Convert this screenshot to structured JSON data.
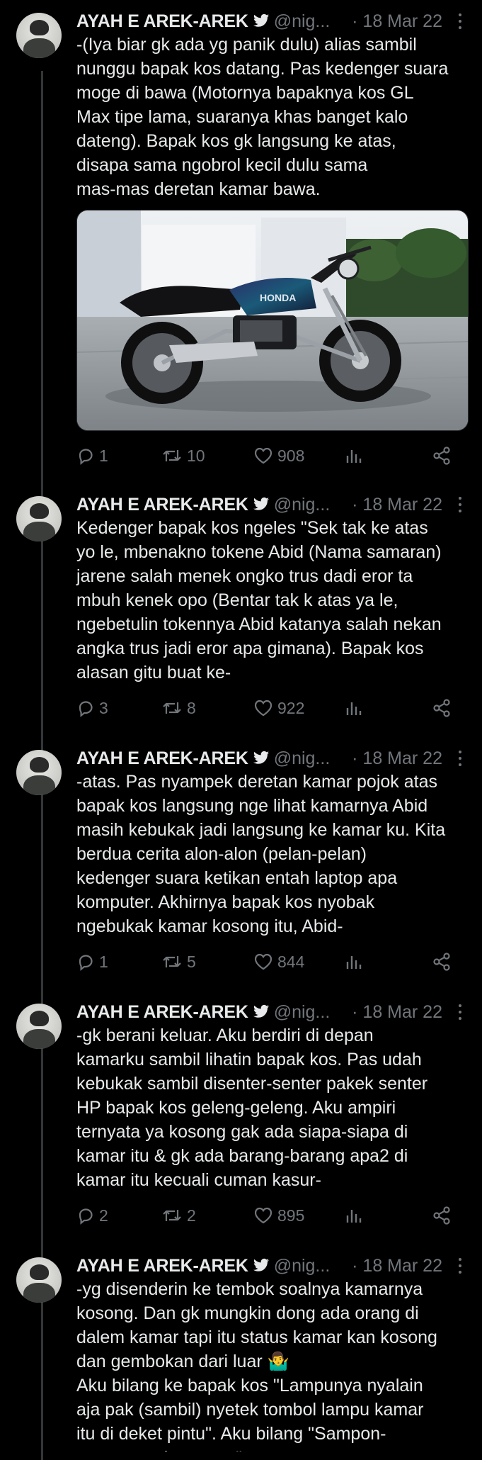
{
  "tweets": [
    {
      "name": "AYAH E AREK-AREK",
      "handle": "@nig...",
      "date": "· 18 Mar 22",
      "text": "-(Iya biar gk ada yg panik dulu) alias sambil\nnunggu bapak kos datang. Pas kedenger suara\nmoge di bawa (Motornya bapaknya kos GL\nMax tipe lama, suaranya khas banget kalo\ndateng). Bapak kos gk langsung ke atas,\ndisapa sama ngobrol kecil dulu sama\nmas-mas deretan kamar bawa.",
      "media": {
        "brand_text": "HONDA",
        "icon": "motorcycle-photo"
      },
      "replies": "1",
      "retweets": "10",
      "likes": "908"
    },
    {
      "name": "AYAH E AREK-AREK",
      "handle": "@nig...",
      "date": "· 18 Mar 22",
      "text": "Kedenger bapak kos ngeles \"Sek tak ke atas\nyo le, mbenakno tokene Abid (Nama samaran)\njarene salah menek ongko trus dadi eror ta\nmbuh kenek opo (Bentar tak k atas ya le,\nngebetulin tokennya Abid katanya salah nekan\nangka trus jadi eror apa gimana). Bapak kos\nalasan gitu buat ke-",
      "replies": "3",
      "retweets": "8",
      "likes": "922"
    },
    {
      "name": "AYAH E AREK-AREK",
      "handle": "@nig...",
      "date": "· 18 Mar 22",
      "text": "-atas. Pas nyampek deretan kamar pojok atas\nbapak kos langsung nge lihat kamarnya Abid\nmasih kebukak jadi langsung ke kamar ku. Kita\nberdua cerita alon-alon (pelan-pelan)\nkedenger suara ketikan entah laptop apa\nkomputer. Akhirnya bapak kos nyobak\nngebukak kamar kosong itu, Abid-",
      "replies": "1",
      "retweets": "5",
      "likes": "844"
    },
    {
      "name": "AYAH E AREK-AREK",
      "handle": "@nig...",
      "date": "· 18 Mar 22",
      "text": "-gk berani keluar. Aku berdiri di depan\nkamarku sambil lihatin bapak kos. Pas udah\nkebukak sambil disenter-senter pakek senter\nHP bapak kos geleng-geleng. Aku ampiri\nternyata ya kosong gak ada siapa-siapa di\nkamar itu & gk ada barang-barang apa2 di\nkamar itu kecuali cuman kasur-",
      "replies": "2",
      "retweets": "2",
      "likes": "895"
    },
    {
      "name": "AYAH E AREK-AREK",
      "handle": "@nig...",
      "date": "· 18 Mar 22",
      "text": "-yg disenderin ke tembok soalnya kamarnya\nkosong. Dan gk mungkin dong ada orang di\ndalem kamar tapi itu status kamar kan kosong\ndan gembokan dari luar 🤷‍♂️\nAku bilang ke bapak kos \"Lampunya nyalain\naja pak (sambil) nyetek tombol lampu kamar\nitu di deket pintu\". Aku bilang \"Sampon-\nsampon pak seng ...\""
    }
  ],
  "colors": {
    "background": "#000000",
    "text": "#e7e9ea",
    "muted": "#71767b",
    "line": "#333639",
    "verified": "#e7e9ea"
  },
  "icons": [
    "avatar",
    "verified-icon",
    "more-icon",
    "reply-icon",
    "retweet-icon",
    "like-icon",
    "views-icon",
    "share-icon"
  ]
}
